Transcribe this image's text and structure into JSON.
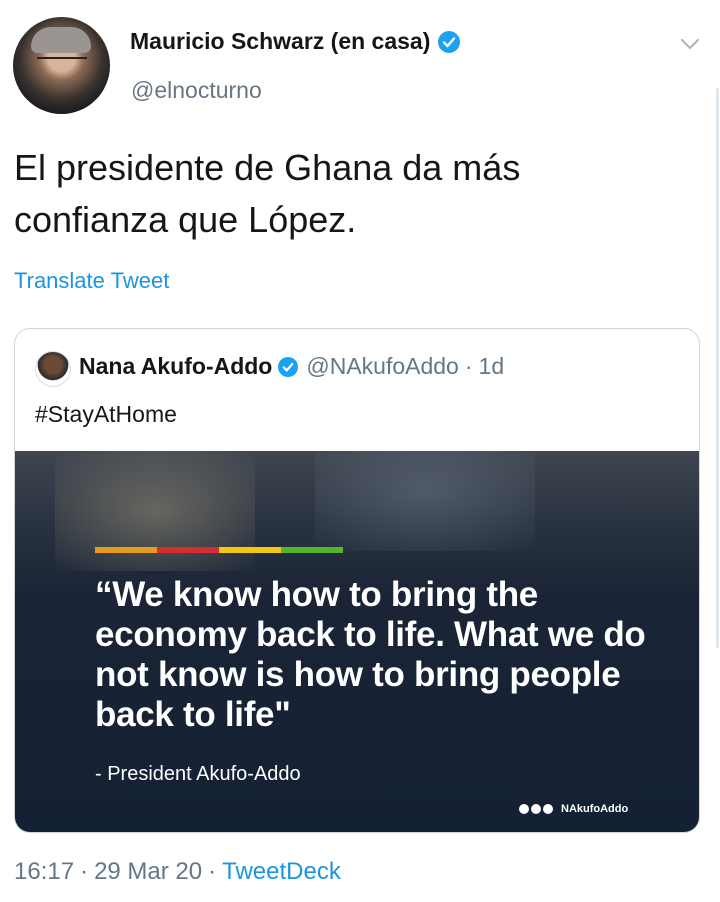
{
  "tweet": {
    "author": {
      "name": "Mauricio Schwarz (en casa)",
      "handle": "@elnocturno",
      "verified": true
    },
    "text": "El presidente de Ghana da más confianza que López.",
    "translate_label": "Translate Tweet",
    "timestamp": "16:17",
    "date": "29 Mar 20",
    "client": "TweetDeck",
    "separator": "·"
  },
  "quote": {
    "author": {
      "name": "Nana Akufo-Addo",
      "handle": "@NAkufoAddo",
      "verified": true
    },
    "age": "1d",
    "text": "#StayAtHome",
    "image": {
      "quote": "“We know how to bring the economy back to life. What we do not know is how to bring people back to life\"",
      "attribution": "- President Akufo-Addo",
      "social_handle": "NAkufoAddo",
      "flag_colors": [
        "#e79a1b",
        "#d32f2f",
        "#f2c811",
        "#52b52d"
      ]
    }
  },
  "colors": {
    "accent": "#1b95e0",
    "verified": "#1da1f2",
    "secondary_text": "#657786"
  },
  "icons": {
    "verified": "verified-badge-icon",
    "menu": "chevron-down-icon"
  }
}
